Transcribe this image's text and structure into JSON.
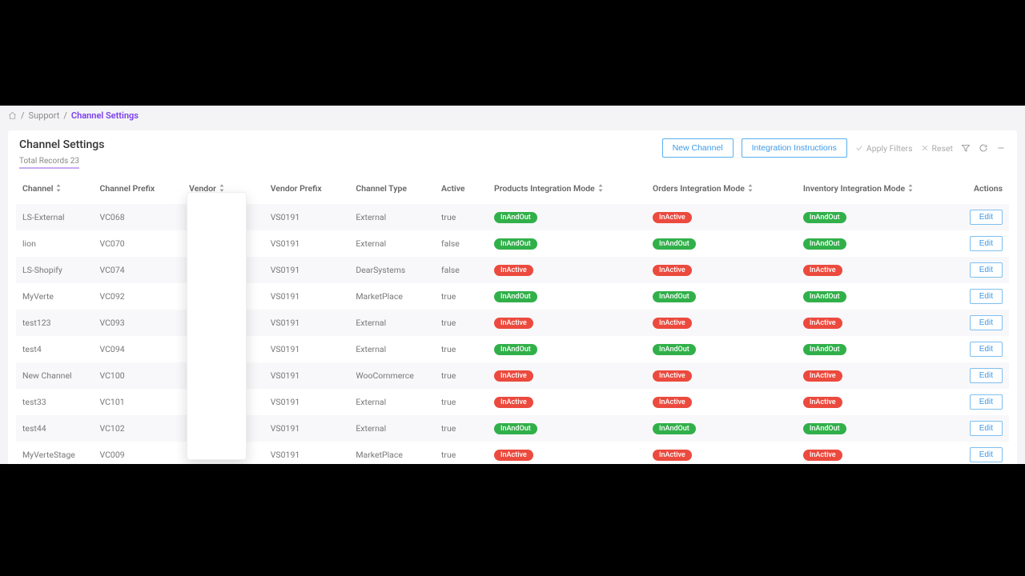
{
  "breadcrumb": {
    "support": "Support",
    "current": "Channel Settings"
  },
  "header": {
    "title": "Channel Settings",
    "subtitle": "Total Records 23",
    "new_channel": "New Channel",
    "instructions": "Integration Instructions",
    "apply_filters": "Apply Filters",
    "reset": "Reset"
  },
  "columns": {
    "channel": "Channel",
    "channel_prefix": "Channel Prefix",
    "vendor": "Vendor",
    "vendor_prefix": "Vendor Prefix",
    "channel_type": "Channel Type",
    "active": "Active",
    "products_mode": "Products Integration Mode",
    "orders_mode": "Orders Integration Mode",
    "inventory_mode": "Inventory Integration Mode",
    "actions": "Actions"
  },
  "pill_labels": {
    "InAndOut": "InAndOut",
    "InActive": "InActive"
  },
  "edit_label": "Edit",
  "rows": [
    {
      "channel": "LS-External",
      "prefix": "VC068",
      "vendor": "",
      "vprefix": "VS0191",
      "ctype": "External",
      "active": "true",
      "products": "InAndOut",
      "orders": "InActive",
      "inventory": "InAndOut"
    },
    {
      "channel": "lion",
      "prefix": "VC070",
      "vendor": "",
      "vprefix": "VS0191",
      "ctype": "External",
      "active": "false",
      "products": "InAndOut",
      "orders": "InAndOut",
      "inventory": "InAndOut"
    },
    {
      "channel": "LS-Shopify",
      "prefix": "VC074",
      "vendor": "",
      "vprefix": "VS0191",
      "ctype": "DearSystems",
      "active": "false",
      "products": "InActive",
      "orders": "InActive",
      "inventory": "InActive"
    },
    {
      "channel": "MyVerte",
      "prefix": "VC092",
      "vendor": "",
      "vprefix": "VS0191",
      "ctype": "MarketPlace",
      "active": "true",
      "products": "InAndOut",
      "orders": "InAndOut",
      "inventory": "InAndOut"
    },
    {
      "channel": "test123",
      "prefix": "VC093",
      "vendor": "",
      "vprefix": "VS0191",
      "ctype": "External",
      "active": "true",
      "products": "InActive",
      "orders": "InActive",
      "inventory": "InActive"
    },
    {
      "channel": "test4",
      "prefix": "VC094",
      "vendor": "",
      "vprefix": "VS0191",
      "ctype": "External",
      "active": "true",
      "products": "InAndOut",
      "orders": "InAndOut",
      "inventory": "InAndOut"
    },
    {
      "channel": "New Channel",
      "prefix": "VC100",
      "vendor": "",
      "vprefix": "VS0191",
      "ctype": "WooCommerce",
      "active": "true",
      "products": "InActive",
      "orders": "InActive",
      "inventory": "InActive"
    },
    {
      "channel": "test33",
      "prefix": "VC101",
      "vendor": "",
      "vprefix": "VS0191",
      "ctype": "External",
      "active": "true",
      "products": "InActive",
      "orders": "InActive",
      "inventory": "InActive"
    },
    {
      "channel": "test44",
      "prefix": "VC102",
      "vendor": "",
      "vprefix": "VS0191",
      "ctype": "External",
      "active": "true",
      "products": "InAndOut",
      "orders": "InAndOut",
      "inventory": "InAndOut"
    },
    {
      "channel": "MyVerteStage",
      "prefix": "VC009",
      "vendor": "",
      "vprefix": "VS0191",
      "ctype": "MarketPlace",
      "active": "true",
      "products": "InActive",
      "orders": "InActive",
      "inventory": "InActive"
    }
  ]
}
